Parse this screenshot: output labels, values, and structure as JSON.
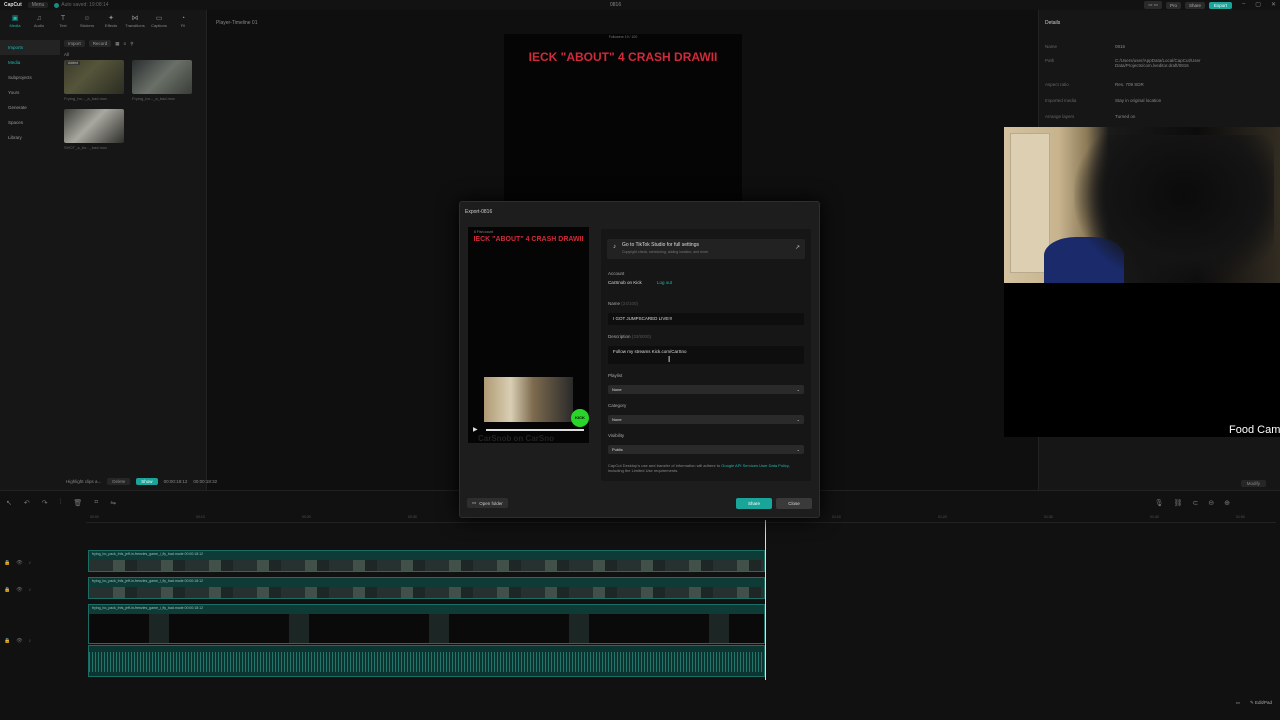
{
  "topbar": {
    "app": "CapCut",
    "menu": "Menu",
    "autosave": "Auto saved: 19:08:14",
    "title": "0816",
    "pro": "Pro",
    "share": "Share",
    "export": "Export"
  },
  "tools": [
    {
      "icon": "▣",
      "label": "Media"
    },
    {
      "icon": "♫",
      "label": "Audio"
    },
    {
      "icon": "T",
      "label": "Text"
    },
    {
      "icon": "☺",
      "label": "Stickers"
    },
    {
      "icon": "✦",
      "label": "Effects"
    },
    {
      "icon": "⋈",
      "label": "Transitions"
    },
    {
      "icon": "▭",
      "label": "Captions"
    },
    {
      "icon": "◔",
      "label": "Fil"
    }
  ],
  "sidenav": [
    "Imports",
    "Media",
    "Subprojects",
    "Yours",
    "Generate",
    "Spaces",
    "Library"
  ],
  "media": {
    "import": "Import",
    "record": "Record",
    "all": "All",
    "items": [
      {
        "badge": "Added",
        "caption": "Frying_bo..._a_bad.mov"
      },
      {
        "badge": "",
        "caption": "Frying_bo..._a_bad.mov"
      },
      {
        "badge": "",
        "caption": "SHOT_a_bo..._bad.mov"
      }
    ]
  },
  "player": {
    "title": "Player-Timeline 01",
    "overlay_top": "Followers 19 / 100",
    "preview_text": "IECK \"ABOUT\" 4 CRASH DRAWII"
  },
  "details": {
    "title": "Details",
    "rows": [
      {
        "k": "Name",
        "v": "0816"
      },
      {
        "k": "Path",
        "v": "C:/Users/user/AppData/Local/CapCut/User Data/Projects/com.lveditor.draft/0816"
      },
      {
        "k": "Aspect ratio",
        "v": "Res. 709 SDR"
      },
      {
        "k": "Imported media",
        "v": "Stay in original location"
      },
      {
        "k": "Arrange layers",
        "v": "Turned on"
      }
    ],
    "modify": "Modify"
  },
  "webcam": {
    "label": "Food Cam"
  },
  "highlight": {
    "label": "Highlight clips a...",
    "delete": "Delete",
    "show": "Show",
    "time": "00:00:18:12",
    "total": "00:00:18:32"
  },
  "timeline": {
    "ticks": [
      "00:00",
      "00:10",
      "00:20",
      "00:30",
      "00:40",
      "00:50",
      "01:00",
      "01:10",
      "01:20",
      "01:30",
      "01:40",
      "01:50"
    ],
    "tracks": [
      "frying_bo_pack_fnfs_jeff-in-frenzies_game_i_fly_bad.mode  00:00:18:12",
      "frying_bo_pack_fnfs_jeff-in-frenzies_game_i_fly_bad.mode  00:00:18:12",
      "frying_bo_pack_fnfs_jeff-in-frenzies_game_i_fly_bad.mode  00:00:18:12"
    ]
  },
  "modal": {
    "title": "Export-0816",
    "preview_head": "6 Fish count",
    "preview_text": "IECK \"ABOUT\" 4 CRASH DRAWII",
    "preview_bottom": "CarSnob on CarSno",
    "kick": "KICK",
    "tiktok": {
      "main": "Go to TikTok Studio for full settings",
      "sub": "Copyright check, scheduling, adding location, and more."
    },
    "account_label": "Account",
    "account_value": "CarSnob on Kick",
    "logout": "Log out",
    "name_label": "Name",
    "name_count": "(24/100)",
    "name_value": "I GOT JUMPSCARED LIVE!!!",
    "desc_label": "Description",
    "desc_count": "(33/5000)",
    "desc_value": "Follow my streams Kick.com/CarSno",
    "playlist_label": "Playlist",
    "playlist_value": "None",
    "category_label": "Category",
    "category_value": "None",
    "visibility_label": "Visibility",
    "visibility_value": "Public",
    "disclaimer_a": "CapCut Desktop's use and transfer of information will adhere to ",
    "disclaimer_link": "Google API Services User Data Policy",
    "disclaimer_b": ", including the Limited Use requirements.",
    "open_folder": "Open folder",
    "share": "Share",
    "close": "Close"
  },
  "bottom_right": {
    "label": "Edit/Pad"
  }
}
